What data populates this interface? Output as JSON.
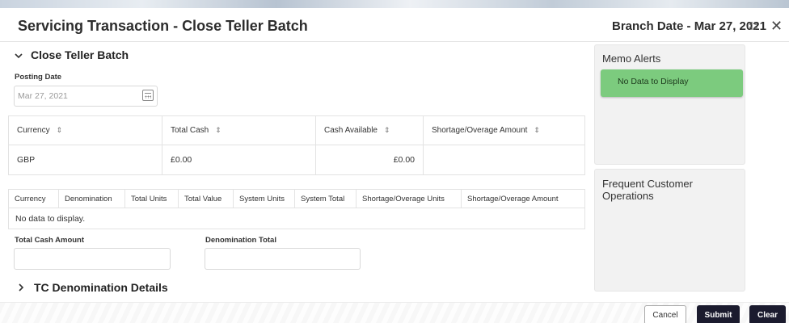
{
  "header": {
    "title": "Servicing Transaction - Close Teller Batch",
    "branch_date": "Branch Date - Mar 27, 2021",
    "shrink_glyph": "⌟⌞⌝⌜",
    "close_glyph": "✕"
  },
  "section": {
    "title": "Close Teller Batch",
    "expand_icon": "chevron-down-icon"
  },
  "posting_date": {
    "label": "Posting Date",
    "value": "Mar 27, 2021"
  },
  "cash_table": {
    "headers": [
      "Currency",
      "Total Cash",
      "Cash Available",
      "Shortage/Overage Amount"
    ],
    "sort_glyph": "⇕",
    "rows": [
      {
        "currency": "GBP",
        "total_cash": "£0.00",
        "cash_available": "£0.00",
        "shortage_overage": ""
      }
    ]
  },
  "denomination_table": {
    "headers": [
      "Currency",
      "Denomination",
      "Total Units",
      "Total Value",
      "System Units",
      "System Total",
      "Shortage/Overage Units",
      "Shortage/Overage Amount"
    ],
    "empty_text": "No data to display."
  },
  "totals": {
    "total_cash_label": "Total Cash Amount",
    "denomination_total_label": "Denomination Total"
  },
  "tc_section": {
    "title": "TC Denomination Details"
  },
  "sidebar": {
    "memo_alerts_title": "Memo Alerts",
    "memo_empty": "No Data to Display",
    "memo_color": "#7ccb7e",
    "frequent_ops_title": "Frequent Customer Operations"
  },
  "buttons": {
    "cancel": "Cancel",
    "submit": "Submit",
    "clear": "Clear",
    "primary_color": "#1b1b2e"
  }
}
